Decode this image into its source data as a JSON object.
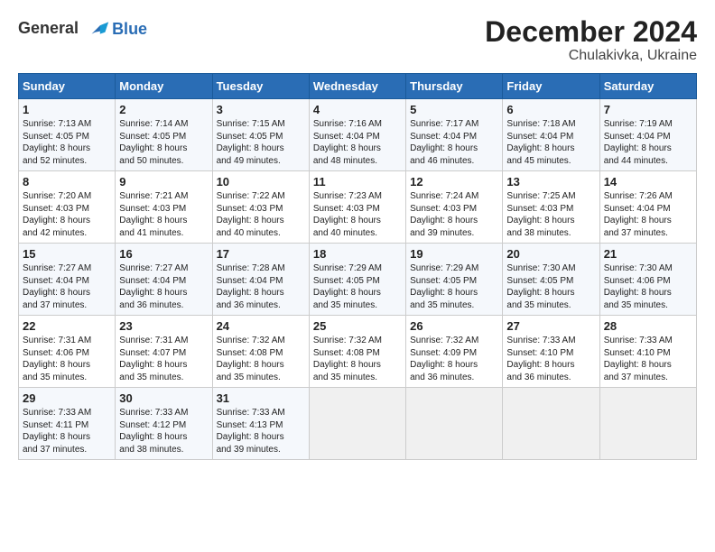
{
  "logo": {
    "line1": "General",
    "line2": "Blue"
  },
  "title": "December 2024",
  "subtitle": "Chulakivka, Ukraine",
  "headers": [
    "Sunday",
    "Monday",
    "Tuesday",
    "Wednesday",
    "Thursday",
    "Friday",
    "Saturday"
  ],
  "weeks": [
    [
      {
        "day": "1",
        "info": "Sunrise: 7:13 AM\nSunset: 4:05 PM\nDaylight: 8 hours\nand 52 minutes."
      },
      {
        "day": "2",
        "info": "Sunrise: 7:14 AM\nSunset: 4:05 PM\nDaylight: 8 hours\nand 50 minutes."
      },
      {
        "day": "3",
        "info": "Sunrise: 7:15 AM\nSunset: 4:05 PM\nDaylight: 8 hours\nand 49 minutes."
      },
      {
        "day": "4",
        "info": "Sunrise: 7:16 AM\nSunset: 4:04 PM\nDaylight: 8 hours\nand 48 minutes."
      },
      {
        "day": "5",
        "info": "Sunrise: 7:17 AM\nSunset: 4:04 PM\nDaylight: 8 hours\nand 46 minutes."
      },
      {
        "day": "6",
        "info": "Sunrise: 7:18 AM\nSunset: 4:04 PM\nDaylight: 8 hours\nand 45 minutes."
      },
      {
        "day": "7",
        "info": "Sunrise: 7:19 AM\nSunset: 4:04 PM\nDaylight: 8 hours\nand 44 minutes."
      }
    ],
    [
      {
        "day": "8",
        "info": "Sunrise: 7:20 AM\nSunset: 4:03 PM\nDaylight: 8 hours\nand 42 minutes."
      },
      {
        "day": "9",
        "info": "Sunrise: 7:21 AM\nSunset: 4:03 PM\nDaylight: 8 hours\nand 41 minutes."
      },
      {
        "day": "10",
        "info": "Sunrise: 7:22 AM\nSunset: 4:03 PM\nDaylight: 8 hours\nand 40 minutes."
      },
      {
        "day": "11",
        "info": "Sunrise: 7:23 AM\nSunset: 4:03 PM\nDaylight: 8 hours\nand 40 minutes."
      },
      {
        "day": "12",
        "info": "Sunrise: 7:24 AM\nSunset: 4:03 PM\nDaylight: 8 hours\nand 39 minutes."
      },
      {
        "day": "13",
        "info": "Sunrise: 7:25 AM\nSunset: 4:03 PM\nDaylight: 8 hours\nand 38 minutes."
      },
      {
        "day": "14",
        "info": "Sunrise: 7:26 AM\nSunset: 4:04 PM\nDaylight: 8 hours\nand 37 minutes."
      }
    ],
    [
      {
        "day": "15",
        "info": "Sunrise: 7:27 AM\nSunset: 4:04 PM\nDaylight: 8 hours\nand 37 minutes."
      },
      {
        "day": "16",
        "info": "Sunrise: 7:27 AM\nSunset: 4:04 PM\nDaylight: 8 hours\nand 36 minutes."
      },
      {
        "day": "17",
        "info": "Sunrise: 7:28 AM\nSunset: 4:04 PM\nDaylight: 8 hours\nand 36 minutes."
      },
      {
        "day": "18",
        "info": "Sunrise: 7:29 AM\nSunset: 4:05 PM\nDaylight: 8 hours\nand 35 minutes."
      },
      {
        "day": "19",
        "info": "Sunrise: 7:29 AM\nSunset: 4:05 PM\nDaylight: 8 hours\nand 35 minutes."
      },
      {
        "day": "20",
        "info": "Sunrise: 7:30 AM\nSunset: 4:05 PM\nDaylight: 8 hours\nand 35 minutes."
      },
      {
        "day": "21",
        "info": "Sunrise: 7:30 AM\nSunset: 4:06 PM\nDaylight: 8 hours\nand 35 minutes."
      }
    ],
    [
      {
        "day": "22",
        "info": "Sunrise: 7:31 AM\nSunset: 4:06 PM\nDaylight: 8 hours\nand 35 minutes."
      },
      {
        "day": "23",
        "info": "Sunrise: 7:31 AM\nSunset: 4:07 PM\nDaylight: 8 hours\nand 35 minutes."
      },
      {
        "day": "24",
        "info": "Sunrise: 7:32 AM\nSunset: 4:08 PM\nDaylight: 8 hours\nand 35 minutes."
      },
      {
        "day": "25",
        "info": "Sunrise: 7:32 AM\nSunset: 4:08 PM\nDaylight: 8 hours\nand 35 minutes."
      },
      {
        "day": "26",
        "info": "Sunrise: 7:32 AM\nSunset: 4:09 PM\nDaylight: 8 hours\nand 36 minutes."
      },
      {
        "day": "27",
        "info": "Sunrise: 7:33 AM\nSunset: 4:10 PM\nDaylight: 8 hours\nand 36 minutes."
      },
      {
        "day": "28",
        "info": "Sunrise: 7:33 AM\nSunset: 4:10 PM\nDaylight: 8 hours\nand 37 minutes."
      }
    ],
    [
      {
        "day": "29",
        "info": "Sunrise: 7:33 AM\nSunset: 4:11 PM\nDaylight: 8 hours\nand 37 minutes."
      },
      {
        "day": "30",
        "info": "Sunrise: 7:33 AM\nSunset: 4:12 PM\nDaylight: 8 hours\nand 38 minutes."
      },
      {
        "day": "31",
        "info": "Sunrise: 7:33 AM\nSunset: 4:13 PM\nDaylight: 8 hours\nand 39 minutes."
      },
      null,
      null,
      null,
      null
    ]
  ]
}
